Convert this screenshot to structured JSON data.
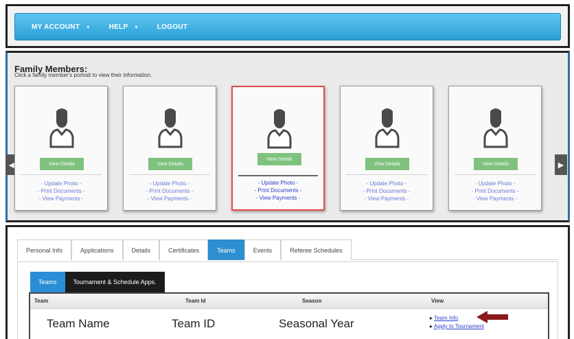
{
  "nav": {
    "items": [
      {
        "label": "MY ACCOUNT",
        "caret": "▾"
      },
      {
        "label": "HELP",
        "caret": "▾"
      },
      {
        "label": "LOGOUT",
        "caret": ""
      }
    ]
  },
  "family": {
    "title": "Family Members:",
    "subtitle": "Click a family member's portrait to view their information.",
    "view_details_label": "View Details",
    "links": [
      "- Update Photo -",
      "- Print Documents -",
      "- View Payments -"
    ],
    "selected_index": 2,
    "card_count": 5,
    "prev_arrow": "◀",
    "next_arrow": "▶"
  },
  "tabs": [
    "Personal Info",
    "Applications",
    "Details",
    "Certificates",
    "Teams",
    "Events",
    "Referee Schedules"
  ],
  "active_tab": "Teams",
  "subtabs": [
    "Teams",
    "Tournament & Schedule Apps."
  ],
  "table": {
    "headers": [
      "Team",
      "Team Id",
      "Season",
      "View"
    ],
    "row": {
      "team": "Team Name",
      "team_id": "Team ID",
      "season": "Seasonal Year"
    },
    "view_links": [
      "Team Info",
      "Apply to Tournament"
    ]
  },
  "colors": {
    "nav_blue": "#2b9fd6",
    "view_details_green": "#7ec27e",
    "selected_border": "#e14a4a",
    "active_tab": "#2e8fd0",
    "arrow_red": "#8b1a1a"
  }
}
